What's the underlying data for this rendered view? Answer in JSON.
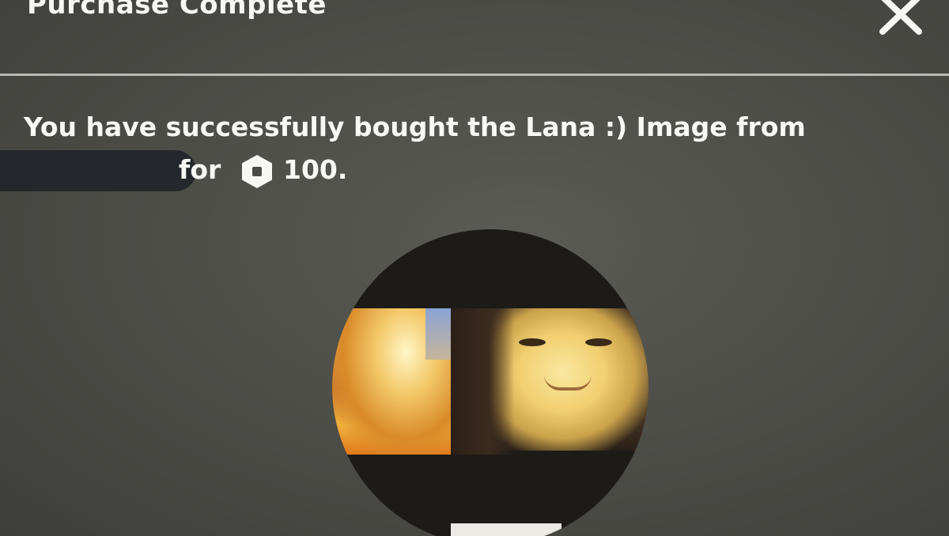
{
  "dialog": {
    "title": "Purchase Complete",
    "close_icon": "close-icon",
    "message_line1": "You have successfully bought the Lana :) Image from",
    "message_for": "for",
    "currency_icon": "robux-icon",
    "price": "100.",
    "image_alt": "Lana :) Image"
  },
  "colors": {
    "background": "#4c4c47",
    "text": "#f4f4f0",
    "divider": "#cfcfc8",
    "redaction": "#24272b"
  }
}
